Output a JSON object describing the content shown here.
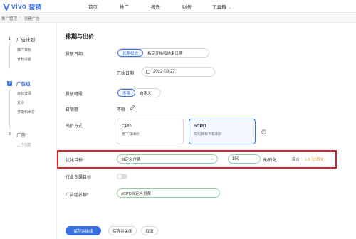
{
  "brand": {
    "logo_text": "vivo",
    "logo_cn": "营销",
    "color": "#3a6fe0"
  },
  "topnav": [
    {
      "label": "首页"
    },
    {
      "label": "推广"
    },
    {
      "label": "报表"
    },
    {
      "label": "财务"
    },
    {
      "label": "工具箱"
    }
  ],
  "breadcrumb": {
    "parent": "推广管理",
    "separator": "/",
    "current": "创建广告"
  },
  "steps": [
    {
      "num": "1",
      "title": "广告计划",
      "subs": [
        "推广目标",
        "计划设置"
      ]
    },
    {
      "num": "2",
      "title": "广告组",
      "subs": [
        "目标详情",
        "受众",
        "排期和出价"
      ]
    },
    {
      "num": "3",
      "title": "广告",
      "subs": [
        "上传创意"
      ]
    }
  ],
  "section_title": "排期与出价",
  "schedule": {
    "label": "投放日期",
    "options": [
      "长期投放",
      "指定开始和结束日期"
    ],
    "selected": "长期投放",
    "start_label": "开始日期",
    "start_date": "2022-09-27"
  },
  "time_slot": {
    "label": "投放时段",
    "options": [
      "不限",
      "自定义"
    ],
    "selected": "不限"
  },
  "daily_budget": {
    "label": "日限额",
    "value": "不限"
  },
  "bid_method": {
    "label": "出价方式",
    "cards": [
      {
        "title": "CPD",
        "desc": "按下载出价"
      },
      {
        "title": "oCPD",
        "desc": "优化目标下载出价"
      }
    ],
    "selected": "oCPD"
  },
  "optimization": {
    "label": "优化目标",
    "required_mark": "*",
    "select_value": "自定义付费",
    "bid_value": "150",
    "bid_unit": "元/转化",
    "floor_label": "底价:",
    "floor_value": "1.5 元/转化"
  },
  "industry_target": {
    "label": "行业专属目标",
    "enabled": false
  },
  "group_name": {
    "label": "广告组名称",
    "required_mark": "*",
    "value": "oCPD自定义付费"
  },
  "buttons": {
    "save_continue": "保存并继续",
    "save_close": "保存并关闭",
    "cancel": "取消"
  },
  "colors": {
    "primary": "#3a6fe0",
    "highlight_border": "#d8262c",
    "floor_price": "#e99a2c",
    "input_border": "#8fd3a3"
  }
}
